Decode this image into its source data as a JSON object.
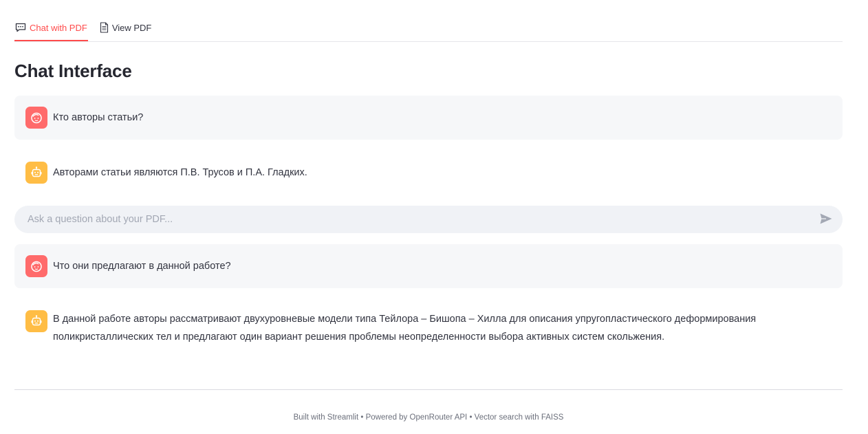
{
  "tabs": [
    {
      "label": "Chat with PDF",
      "icon": "chat-bubble-icon",
      "active": true
    },
    {
      "label": "View PDF",
      "icon": "document-icon",
      "active": false
    }
  ],
  "title": "Chat Interface",
  "messages": [
    {
      "role": "user",
      "avatar": "user-face-icon",
      "text": "Кто авторы статьи?"
    },
    {
      "role": "assistant",
      "avatar": "robot-icon",
      "text": "Авторами статьи являются П.В. Трусов и П.А. Гладких."
    },
    {
      "role": "user",
      "avatar": "user-face-icon",
      "text": "Что они предлагают в данной работе?"
    },
    {
      "role": "assistant",
      "avatar": "robot-icon",
      "text": "В данной работе авторы рассматривают двухуровневые модели типа Тейлора – Бишопа – Хилла для описания упругопластического деформирования поликристаллических тел и предлагают один вариант решения проблемы неопределенности выбора активных систем скольжения."
    }
  ],
  "chat_input": {
    "placeholder": "Ask a question about your PDF...",
    "value": "",
    "send_icon": "send-icon"
  },
  "footer": {
    "text": "Built with Streamlit • Powered by OpenRouter API • Vector search with FAISS"
  },
  "colors": {
    "accent": "#ff4b4b",
    "user_avatar": "#ff6b6b",
    "bot_avatar": "#ffbd45",
    "user_bubble": "#f6f7f9",
    "input_bg": "#f0f2f6"
  }
}
